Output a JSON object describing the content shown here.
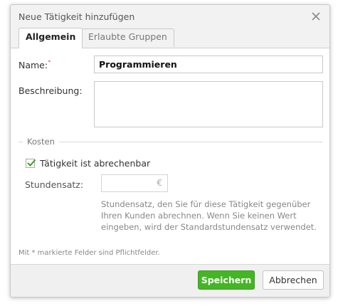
{
  "dialog": {
    "title": "Neue Tätigkeit hinzufügen",
    "close_icon": "close-icon"
  },
  "tabs": [
    {
      "label": "Allgemein",
      "active": true
    },
    {
      "label": "Erlaubte Gruppen",
      "active": false
    }
  ],
  "form": {
    "name_label": "Name:",
    "required_marker": "*",
    "name_value": "Programmieren",
    "description_label": "Beschreibung:",
    "description_value": "",
    "costs_legend": "Kosten",
    "billable_label": "Tätigkeit ist abrechenbar",
    "billable_checked": true,
    "hourly_rate_label": "Stundensatz:",
    "hourly_rate_value": "",
    "hourly_rate_currency": "€",
    "hourly_rate_hint": [
      "Stundensatz, den Sie für diese Tätigkeit gegenüber",
      "Ihren Kunden abrechnen. Wenn Sie keinen Wert",
      "eingeben, wird der Standardstundensatz verwendet."
    ],
    "required_note": "Mit * markierte Felder sind Pflichtfelder."
  },
  "buttons": {
    "save": "Speichern",
    "cancel": "Abbrechen"
  },
  "colors": {
    "save_button": "#45b526",
    "required_marker": "#e05050"
  }
}
